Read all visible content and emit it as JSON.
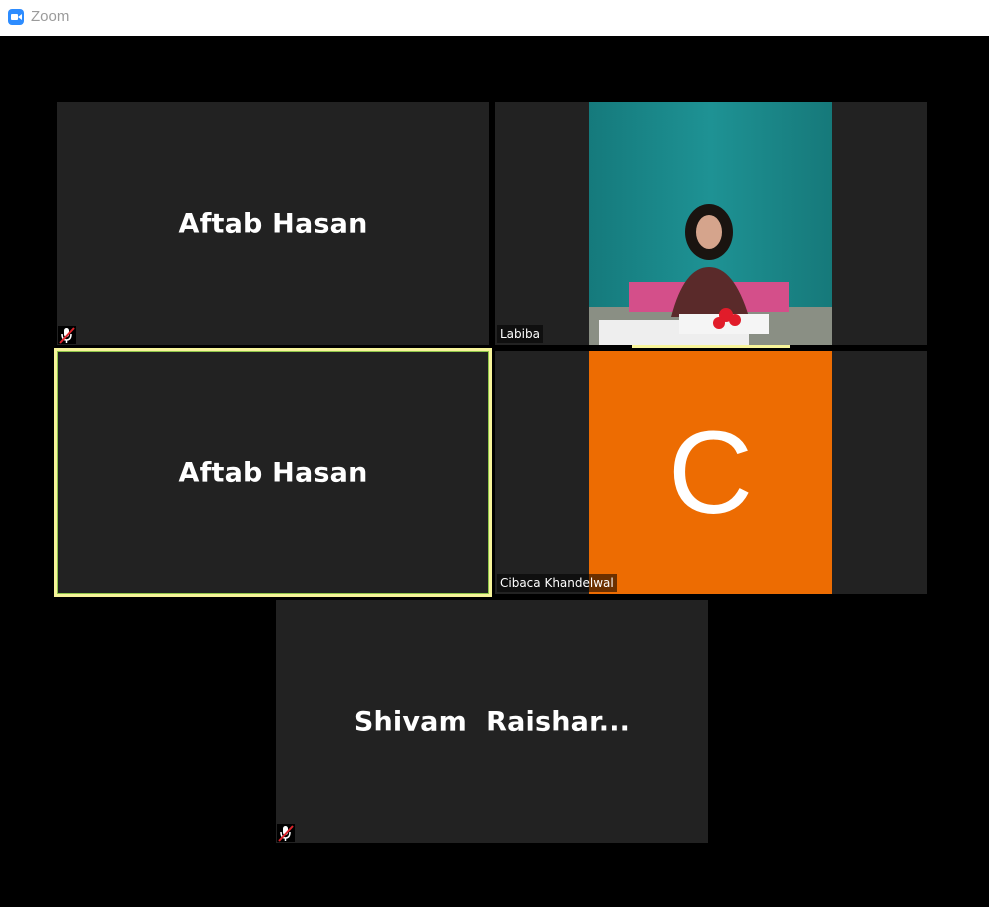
{
  "app": {
    "title": "Zoom"
  },
  "participants": [
    {
      "name": "Aftab Hasan",
      "muted": true
    },
    {
      "name": "Labiba",
      "video": true
    },
    {
      "name": "Aftab Hasan",
      "active_speaker": true
    },
    {
      "name": "Cibaca Khandelwal",
      "avatar_letter": "C",
      "avatar_color": "#ed6c02"
    },
    {
      "name": "Shivam  Raishar...",
      "muted": true
    }
  ]
}
